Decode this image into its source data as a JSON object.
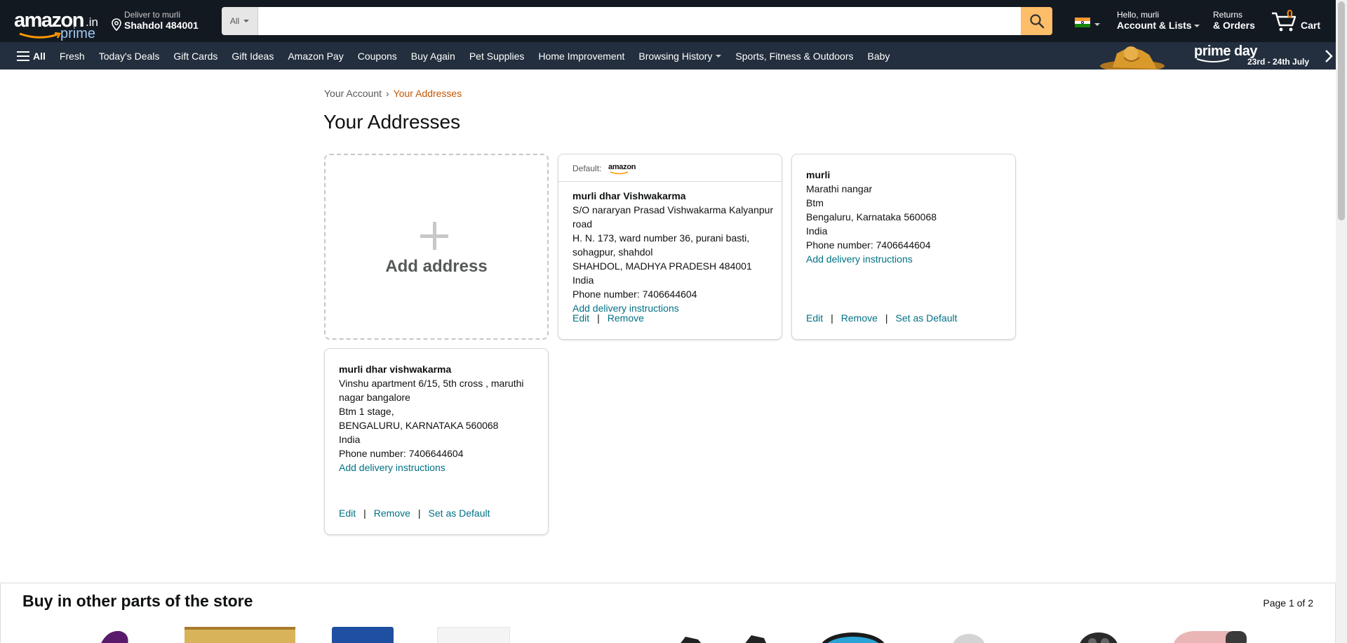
{
  "header": {
    "logo_word": "amazon",
    "logo_tld": ".in",
    "logo_prime": "prime",
    "deliver_line1": "Deliver to murli",
    "deliver_line2": "Shahdol 484001",
    "search_category": "All",
    "search_value": "",
    "search_placeholder": "",
    "account_line1": "Hello, murli",
    "account_line2": "Account & Lists",
    "returns_line1": "Returns",
    "returns_line2": "& Orders",
    "cart_count": "0",
    "cart_label": "Cart"
  },
  "nav": {
    "all_label": "All",
    "items": [
      "Fresh",
      "Today's Deals",
      "Gift Cards",
      "Gift Ideas",
      "Amazon Pay",
      "Coupons",
      "Buy Again",
      "Pet Supplies",
      "Home Improvement",
      "Browsing History",
      "Sports, Fitness & Outdoors",
      "Baby"
    ],
    "promo_title": "prime day",
    "promo_dates": "23rd - 24th July"
  },
  "breadcrumb": {
    "parent": "Your Account",
    "separator": "›",
    "current": "Your Addresses"
  },
  "page_title": "Your Addresses",
  "add_address_label": "Add address",
  "default_label": "Default:",
  "default_brand": "amazon",
  "addresses": [
    {
      "name": "murli dhar Vishwakarma",
      "lines": [
        "S/O nararyan Prasad Vishwakarma Kalyanpur road",
        "H. N. 173, ward number 36, purani basti, sohagpur, shahdol",
        "SHAHDOL, MADHYA PRADESH 484001",
        "India",
        "Phone number: 7406644604"
      ],
      "instructions": "Add delivery instructions",
      "actions": [
        "Edit",
        "Remove"
      ]
    },
    {
      "name": "murli",
      "lines": [
        "Marathi nangar",
        "Btm",
        "Bengaluru, Karnataka 560068",
        "India",
        "Phone number: 7406644604"
      ],
      "instructions": "Add delivery instructions",
      "actions": [
        "Edit",
        "Remove",
        "Set as Default"
      ]
    },
    {
      "name": "murli dhar vishwakarma",
      "lines": [
        "Vinshu apartment 6/15, 5th cross , maruthi nagar bangalore",
        "Btm 1 stage,",
        "BENGALURU, KARNATAKA 560068",
        "India",
        "Phone number: 7406644604"
      ],
      "instructions": "Add delivery instructions",
      "actions": [
        "Edit",
        "Remove",
        "Set as Default"
      ]
    }
  ],
  "other_section": {
    "title": "Buy in other parts of the store",
    "page_indicator": "Page 1 of 2"
  },
  "colors": {
    "header_bg": "#131921",
    "nav_bg": "#232f3e",
    "search_button": "#febd69",
    "link": "#007185",
    "breadcrumb_current": "#c45500",
    "cart_count": "#f08804"
  }
}
